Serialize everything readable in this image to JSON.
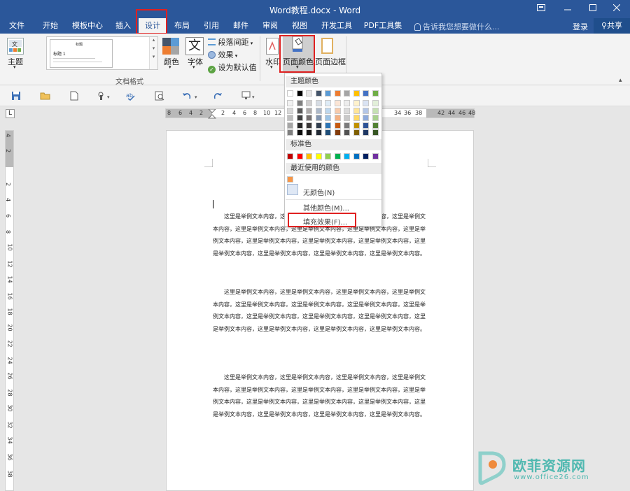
{
  "window": {
    "title": "Word教程.docx - Word"
  },
  "tabs": [
    {
      "label": "文件"
    },
    {
      "label": "开始"
    },
    {
      "label": "模板中心"
    },
    {
      "label": "插入"
    },
    {
      "label": "设计"
    },
    {
      "label": "布局"
    },
    {
      "label": "引用"
    },
    {
      "label": "邮件"
    },
    {
      "label": "审阅"
    },
    {
      "label": "视图"
    },
    {
      "label": "开发工具"
    },
    {
      "label": "PDF工具集"
    }
  ],
  "active_tab": "设计",
  "tell_me": {
    "placeholder": "告诉我您想要做什么..."
  },
  "account": {
    "login": "登录",
    "share": "共享"
  },
  "ribbon": {
    "theme_label": "主题",
    "gallery_thumb_text": "标题 1",
    "gallery_thumb_title": "标题",
    "colors_label": "颜色",
    "fonts_label": "字体",
    "paragraph_spacing_label": "段落间距",
    "effects_label": "效果",
    "set_default_label": "设为默认值",
    "group_doc_format_label": "文档格式",
    "watermark_label": "水印",
    "page_color_label": "页面颜色",
    "page_border_label": "页面边框",
    "fonts_glyph": "文"
  },
  "ruler": {
    "horizontal_numbers": [
      "8",
      "6",
      "4",
      "2",
      "2",
      "4",
      "6",
      "8",
      "10",
      "12",
      "34",
      "36",
      "38",
      "42",
      "44",
      "46",
      "48"
    ],
    "vertical_numbers": [
      "4",
      "2",
      "2",
      "4",
      "6",
      "8",
      "10",
      "12",
      "14",
      "16",
      "18",
      "20",
      "22",
      "24",
      "26",
      "28",
      "30",
      "32",
      "34",
      "36",
      "38"
    ]
  },
  "dropdown": {
    "theme_colors_header": "主题颜色",
    "standard_colors_header": "标准色",
    "recent_colors_header": "最近使用的颜色",
    "no_color": "无颜色(N)",
    "more_colors": "其他颜色(M)...",
    "fill_effects": "填充效果(F)...",
    "theme_top_row": [
      "#ffffff",
      "#000000",
      "#e7e6e6",
      "#44546a",
      "#5b9bd5",
      "#ed7d31",
      "#a5a5a5",
      "#ffc000",
      "#4472c4",
      "#70ad47"
    ],
    "theme_shades": [
      [
        "#f2f2f2",
        "#7f7f7f",
        "#d0cece",
        "#d6dce4",
        "#deebf6",
        "#fbe5d5",
        "#ededed",
        "#fff2cc",
        "#dae3f3",
        "#e2efd9"
      ],
      [
        "#d8d8d8",
        "#595959",
        "#aeabab",
        "#adb9ca",
        "#bdd7ee",
        "#f7cbac",
        "#dbdbdb",
        "#fee599",
        "#b4c6e7",
        "#c5e0b3"
      ],
      [
        "#bfbfbf",
        "#3f3f3f",
        "#757070",
        "#8496b0",
        "#9cc3e5",
        "#f4b183",
        "#c9c9c9",
        "#ffd965",
        "#8eaadb",
        "#a8d08d"
      ],
      [
        "#a5a5a5",
        "#262626",
        "#3a3838",
        "#323f4f",
        "#2e75b5",
        "#c55a11",
        "#7b7b7b",
        "#bf9000",
        "#2f5496",
        "#538135"
      ],
      [
        "#7f7f7f",
        "#0c0c0c",
        "#171616",
        "#222a35",
        "#1e4e79",
        "#833c0b",
        "#525252",
        "#7f6000",
        "#1f3864",
        "#375623"
      ]
    ],
    "standard_row": [
      "#c00000",
      "#ff0000",
      "#ffc000",
      "#ffff00",
      "#92d050",
      "#00b050",
      "#00b0f0",
      "#0070c0",
      "#002060",
      "#7030a0"
    ],
    "recent": [
      "#f79646"
    ]
  },
  "document": {
    "paragraphs": [
      "这里是举例文本内容，这里是举例文本内容，这里是举例文本内容，这里是举例文本内容，这里是举例文本内容，这里是举例文本内容，这里是举例文本内容，这里是举例文本内容，这里是举例文本内容，这里是举例文本内容，这里是举例文本内容，这里是举例文本内容，这里是举例文本内容，这里是举例文本内容，这里是举例文本内容。",
      "这里是举例文本内容，这里是举例文本内容，这里是举例文本内容，这里是举例文本内容，这里是举例文本内容，这里是举例文本内容，这里是举例文本内容，这里是举例文本内容，这里是举例文本内容，这里是举例文本内容，这里是举例文本内容，这里是举例文本内容，这里是举例文本内容，这里是举例文本内容，这里是举例文本内容。",
      "这里是举例文本内容，这里是举例文本内容，这里是举例文本内容，这里是举例文本内容，这里是举例文本内容，这里是举例文本内容，这里是举例文本内容，这里是举例文本内容，这里是举例文本内容，这里是举例文本内容，这里是举例文本内容，这里是举例文本内容，这里是举例文本内容，这里是举例文本内容，这里是举例文本内容。"
    ]
  },
  "watermark": {
    "brand": "欧菲资源网",
    "url": "www.office26.com"
  },
  "colors": {
    "accent": "#2b579a",
    "highlight_box": "#e02020"
  },
  "icons": [
    "restore-icon",
    "minimize-icon",
    "maximize-icon",
    "close-icon",
    "save-icon",
    "open-icon",
    "new-icon",
    "touch-icon",
    "spell-icon",
    "print-preview-icon",
    "undo-icon",
    "redo-icon",
    "screen-icon"
  ]
}
